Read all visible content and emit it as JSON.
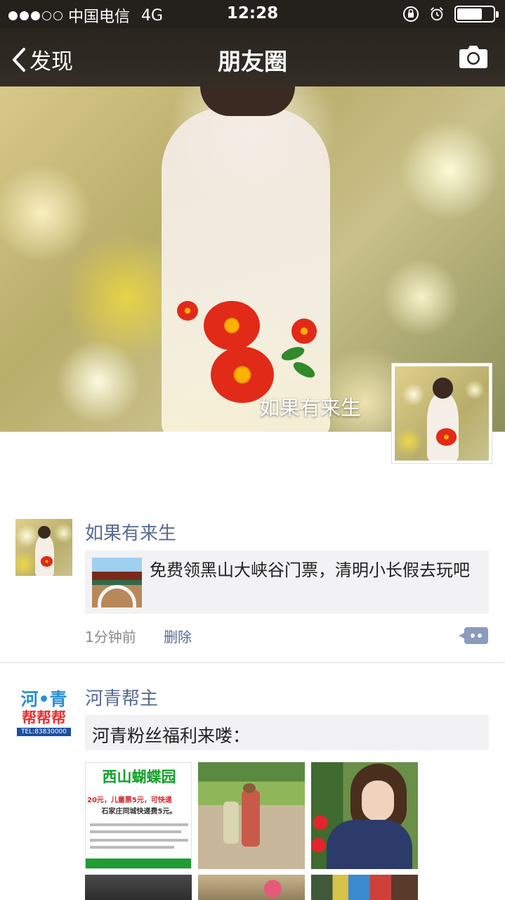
{
  "status_bar": {
    "carrier": "中国电信",
    "network": "4G",
    "time": "12:28",
    "signal_bars_full": 3,
    "signal_bars_total": 5,
    "battery_level": 0.7,
    "icons": [
      "orientation-lock-icon",
      "alarm-icon",
      "battery-icon"
    ]
  },
  "nav": {
    "back_label": "发现",
    "title": "朋友圈",
    "right_icon": "camera-icon"
  },
  "cover": {
    "username": "如果有来生"
  },
  "posts": [
    {
      "name": "如果有来生",
      "share_text": "免费领黑山大峡谷门票，清明小长假去玩吧",
      "time": "1分钟前",
      "delete_label": "删除"
    },
    {
      "name": "河青帮主",
      "text": "河青粉丝福利来喽：",
      "logo": {
        "top": "河•青",
        "middle": "帮帮帮",
        "tel": "TEL:83830000"
      },
      "ad": {
        "title": "西山蝴蝶园",
        "price": "20元，儿童票5元，可快递",
        "note": "石家庄同城快递费5元。"
      }
    }
  ],
  "colors": {
    "nav_bg": "#2a2520",
    "link": "#576b95",
    "box_bg": "#f2f2f4"
  }
}
